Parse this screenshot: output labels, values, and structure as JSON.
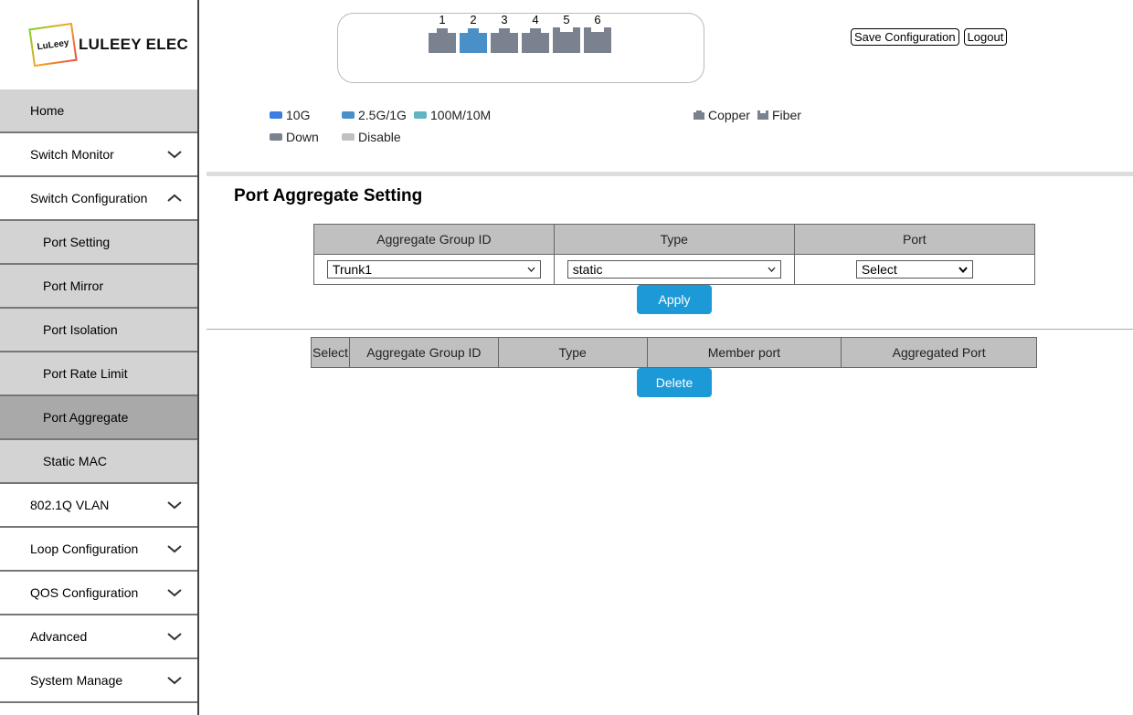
{
  "brand": {
    "badge": "LuLeey",
    "name": "LULEEY ELEC"
  },
  "sidebar": {
    "items": [
      {
        "label": "Home"
      },
      {
        "label": "Switch Monitor"
      },
      {
        "label": "Switch Configuration"
      },
      {
        "label": "Port Setting"
      },
      {
        "label": "Port Mirror"
      },
      {
        "label": "Port Isolation"
      },
      {
        "label": "Port Rate Limit"
      },
      {
        "label": "Port Aggregate"
      },
      {
        "label": "Static MAC"
      },
      {
        "label": "802.1Q VLAN"
      },
      {
        "label": "Loop Configuration"
      },
      {
        "label": "QOS Configuration"
      },
      {
        "label": "Advanced"
      },
      {
        "label": "System Manage"
      }
    ]
  },
  "ports": [
    {
      "num": "1",
      "state": "down"
    },
    {
      "num": "2",
      "state": "2.5G/1G"
    },
    {
      "num": "3",
      "state": "down"
    },
    {
      "num": "4",
      "state": "down"
    },
    {
      "num": "5",
      "state": "down"
    },
    {
      "num": "6",
      "state": "down"
    }
  ],
  "header": {
    "save_label": "Save Configuration",
    "logout_label": "Logout"
  },
  "legend": {
    "speed_10g": "10G",
    "speed_2_5g": "2.5G/1G",
    "speed_100m": "100M/10M",
    "down": "Down",
    "disable": "Disable",
    "copper": "Copper",
    "fiber": "Fiber"
  },
  "colors": {
    "10g": "#3d7ee0",
    "2_5g": "#4a90c8",
    "100m": "#62b5c0",
    "down": "#7a8290",
    "disable": "#c0c0c0",
    "accent": "#1c9ad8"
  },
  "main": {
    "title": "Port Aggregate Setting",
    "form": {
      "headers": [
        "Aggregate Group ID",
        "Type",
        "Port"
      ],
      "group_value": "Trunk1",
      "type_value": "static",
      "port_value": "Select",
      "apply_label": "Apply"
    },
    "list": {
      "headers": [
        "Select",
        "Aggregate Group ID",
        "Type",
        "Member port",
        "Aggregated Port"
      ],
      "delete_label": "Delete"
    }
  }
}
